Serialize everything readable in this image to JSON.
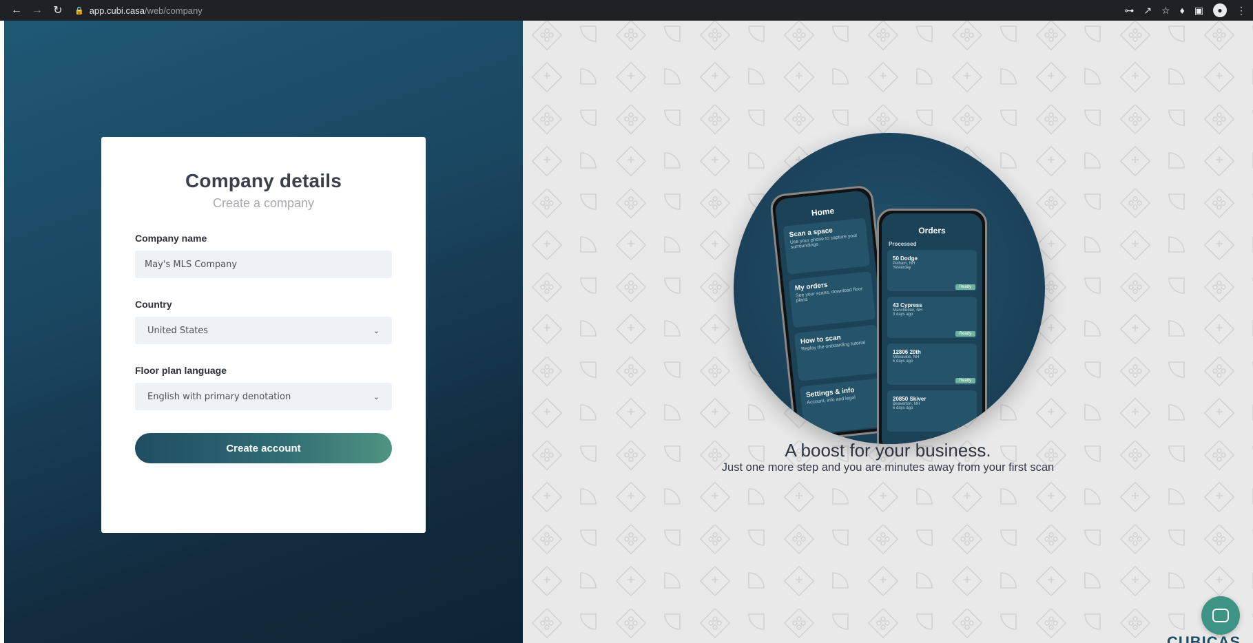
{
  "browser": {
    "url_host": "app.cubi.casa",
    "url_path": "/web/company"
  },
  "form": {
    "title": "Company details",
    "subtitle": "Create a company",
    "company_name_label": "Company name",
    "company_name_value": "May's MLS Company",
    "country_label": "Country",
    "country_value": "United States",
    "language_label": "Floor plan language",
    "language_value": "English with primary denotation",
    "submit_label": "Create account"
  },
  "promo": {
    "headline": "A boost for your business.",
    "subline": "Just one more step and you are minutes away from your first scan",
    "phone_home": {
      "title": "Home",
      "tiles": [
        {
          "title": "Scan a space",
          "desc": "Use your phone to capture your surroundings"
        },
        {
          "title": "My orders",
          "desc": "See your scans, download floor plans"
        },
        {
          "title": "How to scan",
          "desc": "Replay the onboarding tutorial"
        },
        {
          "title": "Settings & info",
          "desc": "Account, info and legal"
        }
      ]
    },
    "phone_orders": {
      "title": "Orders",
      "section": "Processed",
      "orders": [
        {
          "address": "50 Dodge",
          "city": "Pelham, NH",
          "time": "Yesterday",
          "status": "Ready"
        },
        {
          "address": "43 Cypress",
          "city": "Manchester, NH",
          "time": "3 days ago",
          "status": "Ready"
        },
        {
          "address": "12806 20th",
          "city": "Milwaukie, NH",
          "time": "5 days ago",
          "status": "Ready"
        },
        {
          "address": "20850 Skiver",
          "city": "Beaverton, NH",
          "time": "6 days ago",
          "status": ""
        }
      ]
    },
    "brand_text": "CUBICAS"
  },
  "colors": {
    "accent_teal": "#3e9484",
    "dark_blue": "#1f4d63"
  }
}
